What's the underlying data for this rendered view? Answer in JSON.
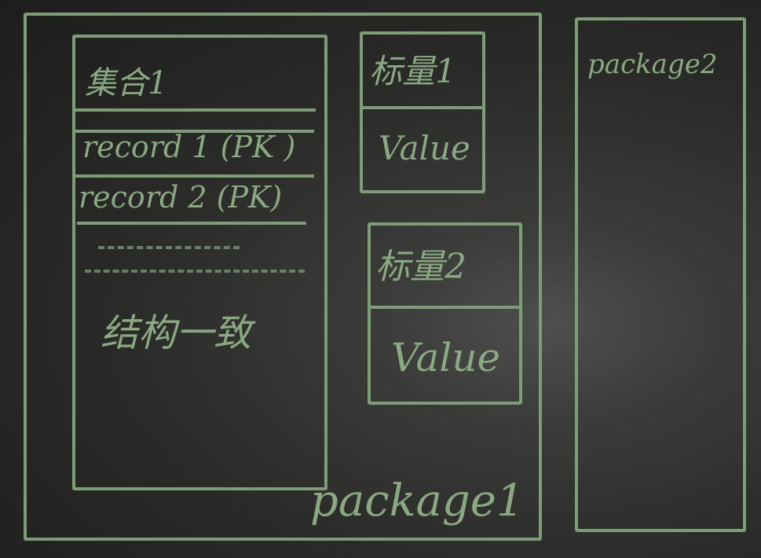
{
  "package1": {
    "label": "package1",
    "collection": {
      "title": "集合1",
      "records": [
        "record 1 (PK )",
        "record 2 (PK)"
      ],
      "note": "结构一致"
    },
    "scalars": [
      {
        "title": "标量1",
        "value": "Value"
      },
      {
        "title": "标量2",
        "value": "Value"
      }
    ]
  },
  "package2": {
    "label": "package2"
  }
}
